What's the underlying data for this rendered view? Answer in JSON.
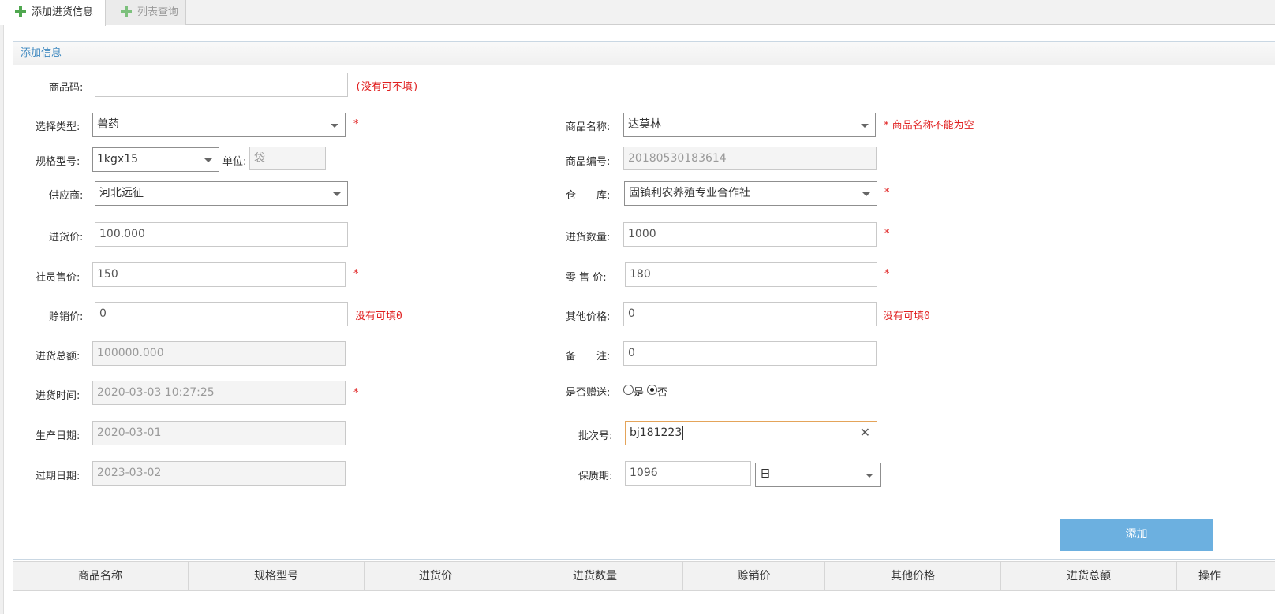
{
  "tabs": [
    {
      "label": "添加进货信息",
      "active": true,
      "icon": "plus-icon"
    },
    {
      "label": "列表查询",
      "active": false,
      "icon": "plus-icon"
    }
  ],
  "panel": {
    "title": "添加信息"
  },
  "form": {
    "product_code": {
      "label": "商品码:",
      "value": "",
      "hint": "(没有可不填)"
    },
    "category": {
      "label": "选择类型:",
      "value": "兽药",
      "required": "*"
    },
    "product_name": {
      "label": "商品名称:",
      "value": "达莫林",
      "error": "* 商品名称不能为空"
    },
    "spec": {
      "label": "规格型号:",
      "value": "1kgx15"
    },
    "unit": {
      "label": "单位:",
      "value": "袋"
    },
    "product_no": {
      "label": "商品编号:",
      "value": "20180530183614"
    },
    "supplier": {
      "label": "供应商:",
      "value": "河北远征"
    },
    "warehouse": {
      "label": "仓　　库:",
      "value": "固镇利农养殖专业合作社",
      "required": "*"
    },
    "purchase_price": {
      "label": "进货价:",
      "value": "100.000"
    },
    "purchase_qty": {
      "label": "进货数量:",
      "value": "1000",
      "required": "*"
    },
    "member_price": {
      "label": "社员售价:",
      "value": "150",
      "required": "*"
    },
    "retail_price": {
      "label": "零 售 价:",
      "value": "180",
      "required": "*"
    },
    "credit_price": {
      "label": "赊销价:",
      "value": "0",
      "hint": "没有可填0"
    },
    "other_price": {
      "label": "其他价格:",
      "value": "0",
      "hint": "没有可填0"
    },
    "purchase_total": {
      "label": "进货总额:",
      "value": "100000.000"
    },
    "remark": {
      "label": "备　　注:",
      "value": "0"
    },
    "purchase_time": {
      "label": "进货时间:",
      "value": "2020-03-03 10:27:25",
      "required": "*"
    },
    "is_gift": {
      "label": "是否赠送:",
      "options": [
        "是",
        "否"
      ],
      "selected": "否"
    },
    "production_date": {
      "label": "生产日期:",
      "value": "2020-03-01"
    },
    "batch_no": {
      "label": "批次号:",
      "value": "bj181223"
    },
    "expiry_date": {
      "label": "过期日期:",
      "value": "2023-03-02"
    },
    "shelf_life": {
      "label": "保质期:",
      "value": "1096",
      "unit": "日"
    }
  },
  "add_button": {
    "label": "添加"
  },
  "table": {
    "columns": [
      "商品名称",
      "规格型号",
      "进货价",
      "进货数量",
      "赊销价",
      "其他价格",
      "进货总额",
      "操作"
    ]
  },
  "colors": {
    "accent": "#6cb0e0",
    "required": "#e02020",
    "focus": "#e4a45a",
    "header_text": "#3c87bf"
  }
}
